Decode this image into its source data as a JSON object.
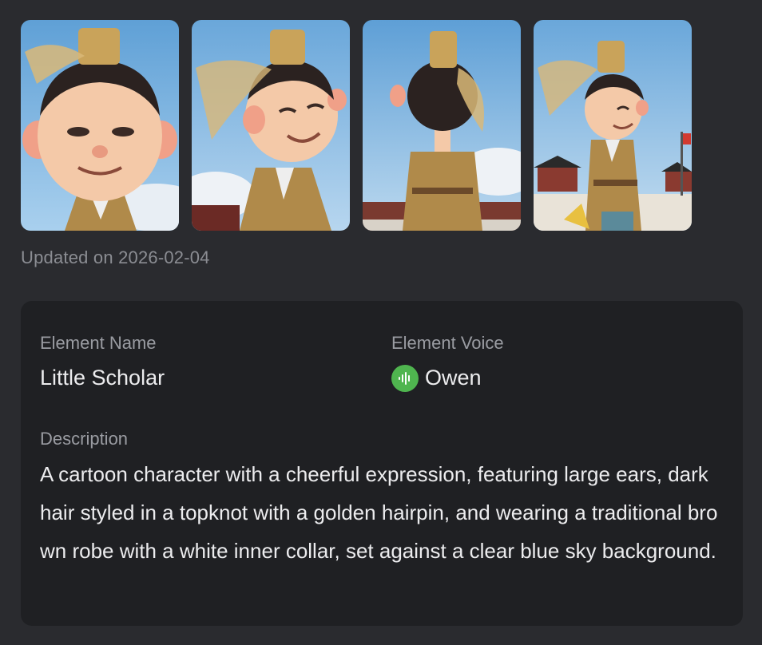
{
  "gallery": {
    "images": [
      {
        "alt": "character-closeup-front"
      },
      {
        "alt": "character-smiling-half-body"
      },
      {
        "alt": "character-back-view"
      },
      {
        "alt": "character-full-body-palace"
      }
    ]
  },
  "updated_text": "Updated on 2026-02-04",
  "details": {
    "name_label": "Element Name",
    "name_value": "Little Scholar",
    "voice_label": "Element Voice",
    "voice_value": "Owen",
    "voice_icon": "sound-wave-icon",
    "voice_icon_color": "#4fb54f",
    "description_label": "Description",
    "description_text": "A cartoon character with a cheerful expression, featuring large ears, dark hair styled in a topknot with a golden hairpin, and wearing a traditional brown robe with a white inner collar, set against a clear blue sky background."
  },
  "colors": {
    "page_bg": "#2a2b2f",
    "card_bg": "#1f2023",
    "label": "#9a9ca2",
    "value": "#ececee"
  }
}
